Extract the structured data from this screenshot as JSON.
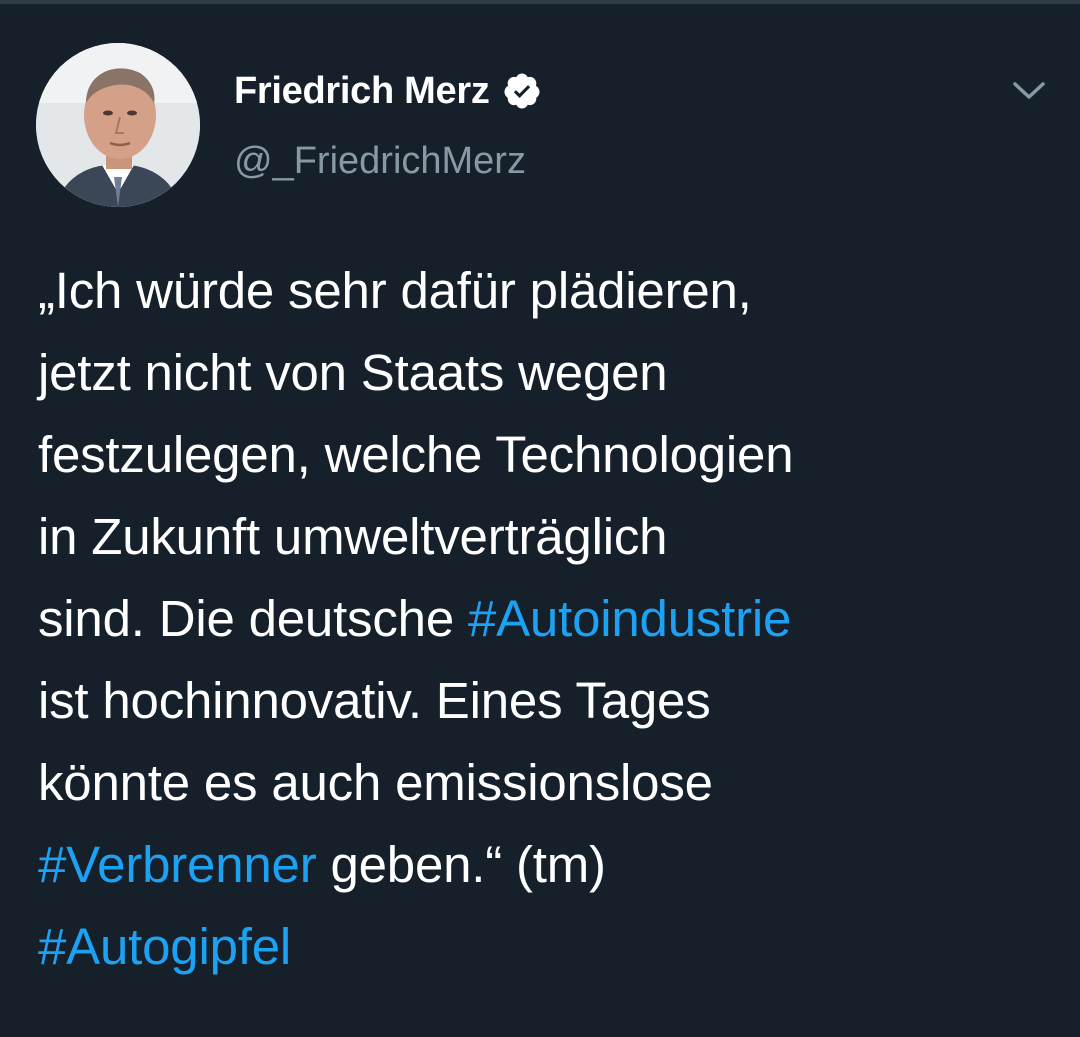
{
  "colors": {
    "background": "#15202b",
    "text": "#ffffff",
    "secondary_text": "#8899a6",
    "link": "#1da1f2"
  },
  "author": {
    "display_name": "Friedrich Merz",
    "handle": "@_FriedrichMerz",
    "verified": true,
    "verified_icon": "verified-badge-icon",
    "avatar_icon": "profile-photo"
  },
  "menu": {
    "icon": "chevron-down-icon"
  },
  "tweet": {
    "lines": [
      [
        {
          "text": "„Ich würde sehr dafür plädieren,"
        }
      ],
      [
        {
          "text": "jetzt nicht von Staats wegen"
        }
      ],
      [
        {
          "text": "festzulegen, welche Technologien"
        }
      ],
      [
        {
          "text": "in Zukunft umweltverträglich"
        }
      ],
      [
        {
          "text": "sind. Die deutsche "
        },
        {
          "text": "#Autoindustrie",
          "hashtag": true
        }
      ],
      [
        {
          "text": "ist hochinnovativ. Eines Tages"
        }
      ],
      [
        {
          "text": "könnte es auch emissionslose"
        }
      ],
      [
        {
          "text": "#Verbrenner",
          "hashtag": true
        },
        {
          "text": " geben.“ (tm)"
        }
      ],
      [
        {
          "text": "#Autogipfel",
          "hashtag": true
        }
      ]
    ]
  }
}
